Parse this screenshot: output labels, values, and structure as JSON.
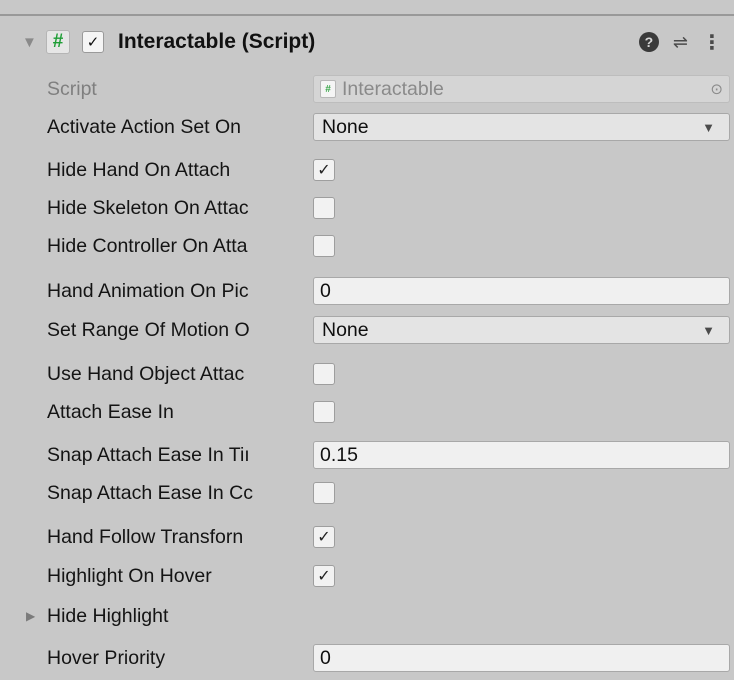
{
  "component": {
    "title": "Interactable (Script)",
    "enabled_check": "✓",
    "foldout_glyph": "▼",
    "hash_glyph": "#",
    "help_glyph": "?",
    "presets_glyph": "⇌",
    "menu_glyph": "⋮"
  },
  "fields": {
    "script": {
      "label": "Script",
      "value": "Interactable",
      "icon": "script-icon",
      "picker_glyph": "⊙"
    },
    "activate_action_set": {
      "label": "Activate Action Set On",
      "value": "None",
      "arrow": "▼"
    },
    "hide_hand_on_attach": {
      "label": "Hide Hand On Attach",
      "checked": "✓"
    },
    "hide_skeleton_on_attach": {
      "label": "Hide Skeleton On Attac",
      "checked": ""
    },
    "hide_controller_on_attach": {
      "label": "Hide Controller On Atta",
      "checked": ""
    },
    "hand_animation_on_pickup": {
      "label": "Hand Animation On Pic",
      "value": "0"
    },
    "set_range_of_motion": {
      "label": "Set Range Of Motion O",
      "value": "None",
      "arrow": "▼"
    },
    "use_hand_object_attach": {
      "label": "Use Hand Object Attac",
      "checked": ""
    },
    "attach_ease_in": {
      "label": "Attach Ease In",
      "checked": ""
    },
    "snap_attach_ease_in_time": {
      "label": "Snap Attach Ease In Tiı",
      "value": "0.15"
    },
    "snap_attach_ease_in_completed": {
      "label": "Snap Attach Ease In Cc",
      "checked": ""
    },
    "hand_follow_transform": {
      "label": "Hand Follow Transforn",
      "checked": "✓"
    },
    "highlight_on_hover": {
      "label": "Highlight On Hover",
      "checked": "✓"
    },
    "hide_highlight": {
      "label": "Hide Highlight",
      "fold_glyph": "▶"
    },
    "hover_priority": {
      "label": "Hover Priority",
      "value": "0"
    }
  },
  "colors": {
    "background": "#c8c8c8",
    "field": "#f0f0f0",
    "script_hash": "#1f9e36"
  }
}
